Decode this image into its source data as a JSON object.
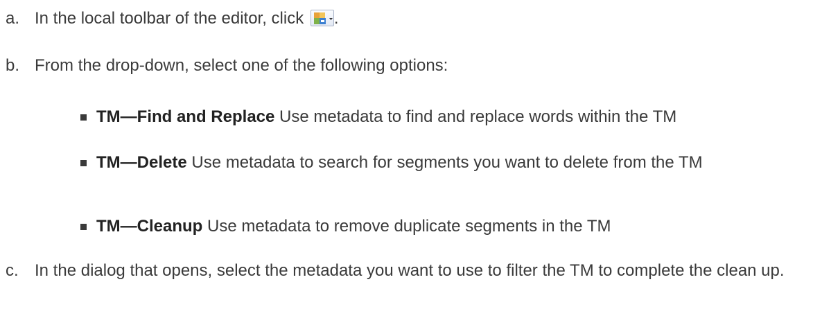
{
  "steps": [
    {
      "marker": "a.",
      "text_before": "In the local toolbar of the editor, click",
      "text_after": ".",
      "icon": "tm-tools-dropdown-icon"
    },
    {
      "marker": "b.",
      "text": "From the drop-down, select one of the following options:"
    },
    {
      "marker": "c.",
      "text": "In the dialog that opens, select the metadata you want to use to filter the TM to complete the clean up."
    }
  ],
  "options": [
    {
      "term": "TM—Find and Replace",
      "desc": " Use metadata to find and replace words within the TM"
    },
    {
      "term": "TM—Delete",
      "desc": " Use metadata to search for segments you want to delete from the TM"
    },
    {
      "term": "TM—Cleanup",
      "desc": " Use metadata to remove duplicate segments in the TM"
    }
  ]
}
